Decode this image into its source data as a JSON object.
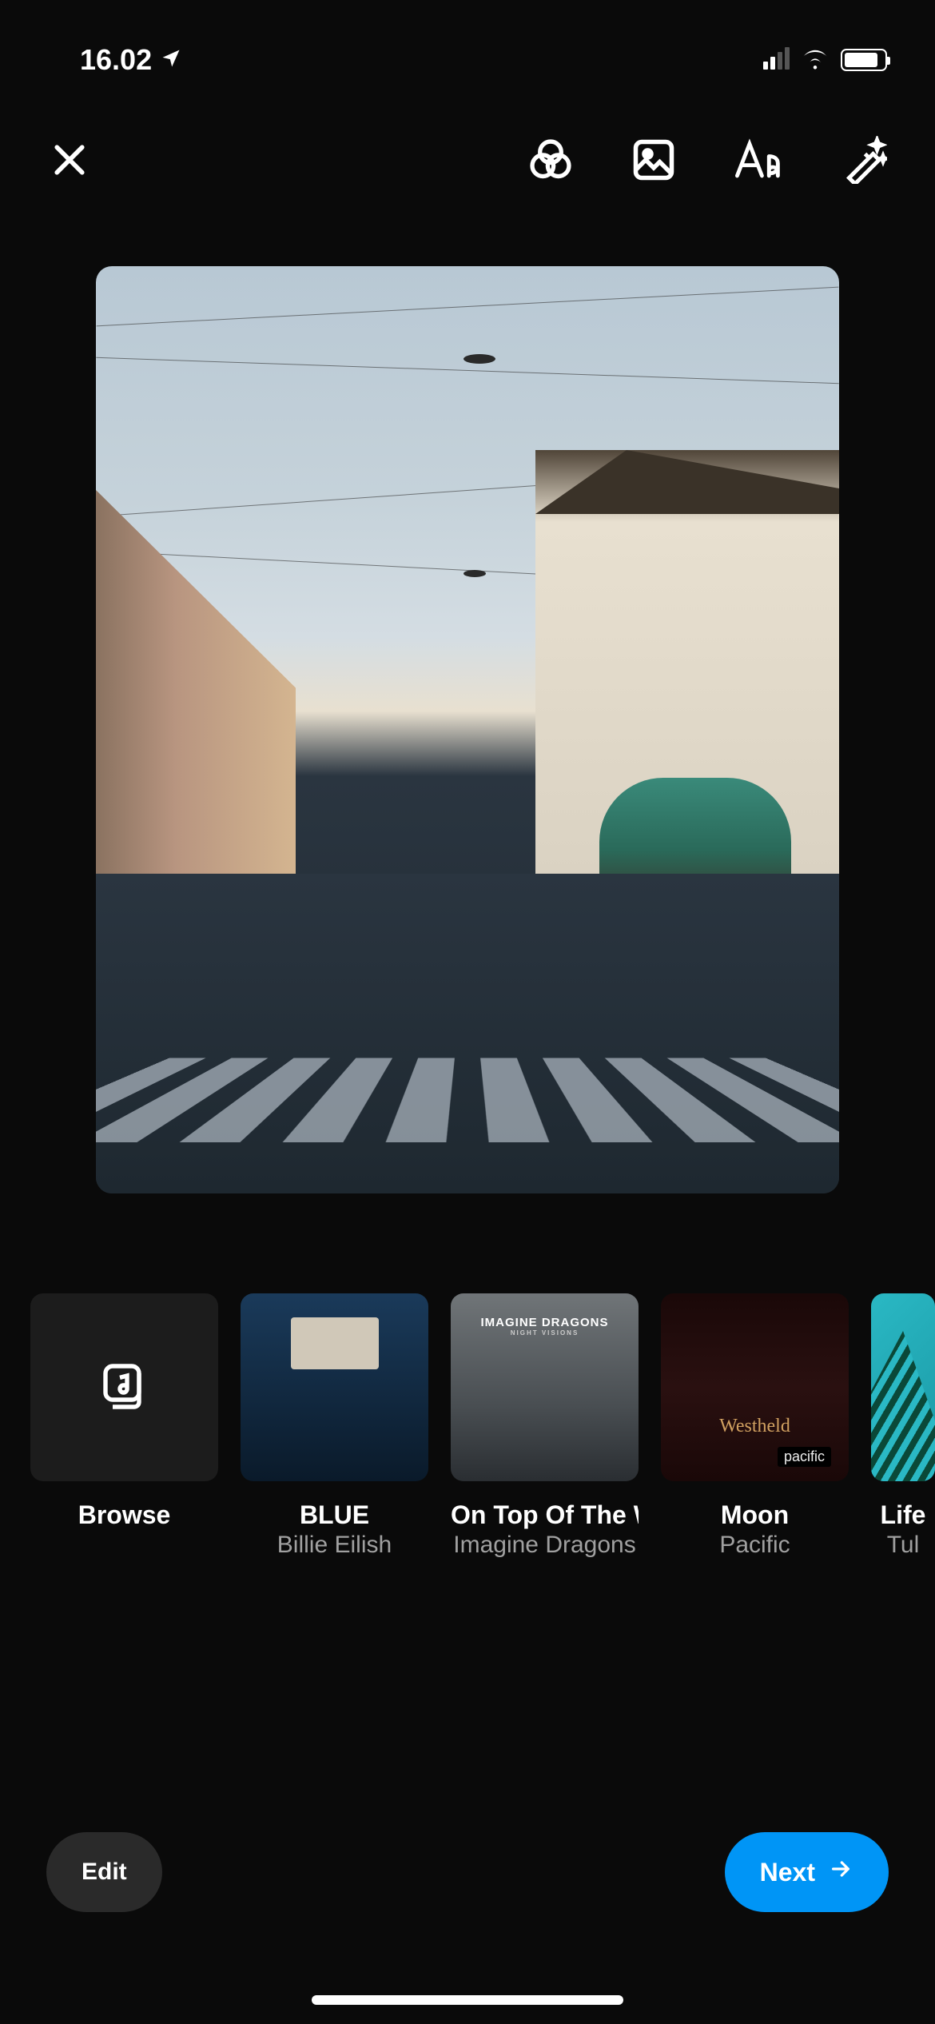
{
  "statusBar": {
    "time": "16.02"
  },
  "music": {
    "browse": "Browse",
    "items": [
      {
        "title": "BLUE",
        "artist": "Billie Eilish"
      },
      {
        "title": "On Top Of The World",
        "artist": "Imagine Dragons"
      },
      {
        "title": "Moon",
        "artist": "Pacific"
      },
      {
        "title": "Life",
        "artist": "Tul"
      }
    ]
  },
  "bottomBar": {
    "edit": "Edit",
    "next": "Next"
  },
  "coverLabels": {
    "dragons": "IMAGINE DRAGONS",
    "dragonsSub": "NIGHT VISIONS",
    "moonScript": "Westheld",
    "moonTag": "pacific"
  }
}
